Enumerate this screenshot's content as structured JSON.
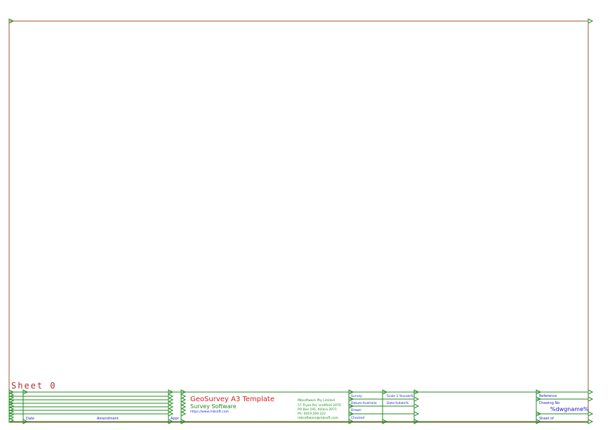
{
  "sheet_label": "Sheet 0",
  "revision_block": {
    "col_date": "Date",
    "col_amendment": "Amendment",
    "col_appr": "Appr"
  },
  "title": {
    "template": "GeoSurvey A3 Template",
    "software": "Survey Software",
    "website": "https://www.mbsoft.com"
  },
  "company": {
    "name": "Mbsoftware Pty Limited",
    "address1": "57 Tryon Rd, Lindfield 2070",
    "address2": "PO Box 191, Killara 2071",
    "phone": "Ph: 0419 269 222",
    "email": "mbsoftware@mbsoft.com"
  },
  "signoff": {
    "survey": "Survey",
    "scale": "Scale 1:%scale%",
    "datum": "Datum:Australia",
    "design": "Date:%date%",
    "drawn": "Drawn",
    "checked": "Checked"
  },
  "reference_block": {
    "reference": "Reference",
    "drawing_no": "Drawing No",
    "dwgname": "%dwgname%",
    "sheet_of": "Sheet   of"
  },
  "colors": {
    "border": "#a0522d",
    "block_lines": "#228b22",
    "accent_red": "#d42020",
    "accent_green": "#1f8a1f",
    "accent_blue": "#1a1acc"
  }
}
